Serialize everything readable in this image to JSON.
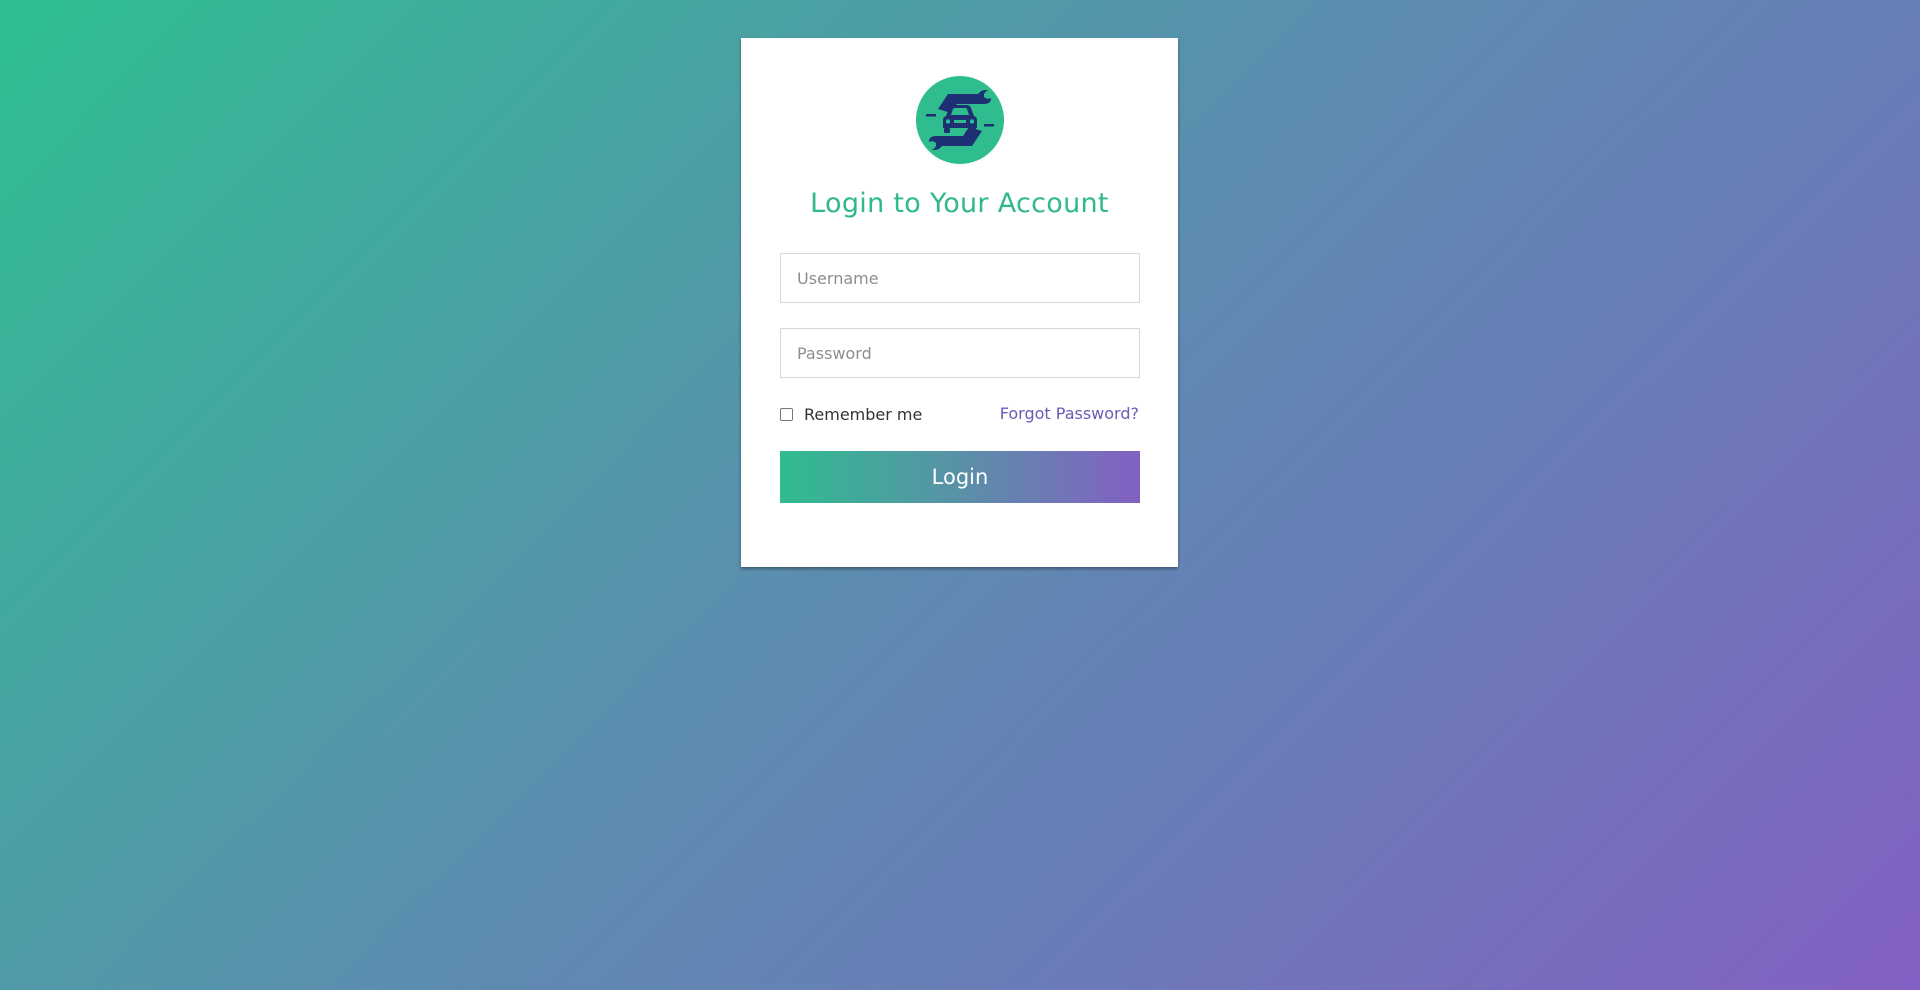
{
  "login": {
    "logo_icon": "car-service-logo-icon",
    "title": "Login to Your Account",
    "username_placeholder": "Username",
    "password_placeholder": "Password",
    "remember_label": "Remember me",
    "remember_checked": false,
    "forgot_label": "Forgot Password?",
    "login_label": "Login"
  },
  "colors": {
    "accent_green": "#2fbc8f",
    "accent_purple": "#8360c3",
    "logo_dark": "#1f2f73",
    "link": "#6a5bb5"
  }
}
